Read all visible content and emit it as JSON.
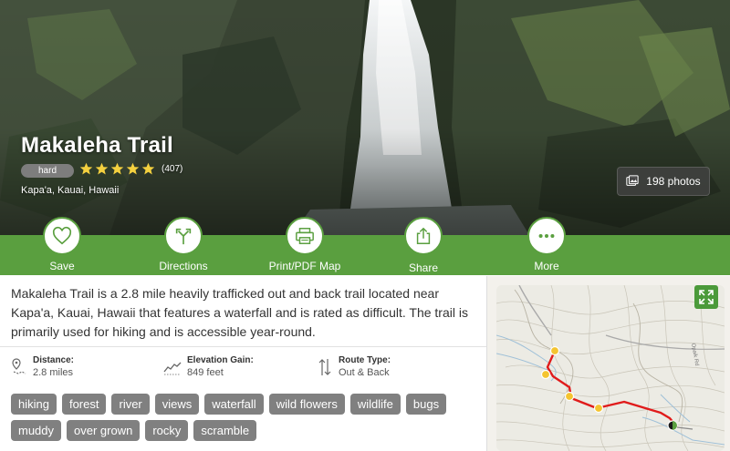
{
  "trail": {
    "title": "Makaleha Trail",
    "difficulty": "hard",
    "rating": 5,
    "review_count": "(407)",
    "location": "Kapa'a, Kauai, Hawaii",
    "photos_label": "198 photos"
  },
  "actions": [
    {
      "label": "Save",
      "icon": "heart-icon"
    },
    {
      "label": "Directions",
      "icon": "directions-icon"
    },
    {
      "label": "Print/PDF Map",
      "icon": "printer-icon"
    },
    {
      "label": "Share",
      "icon": "share-icon"
    },
    {
      "label": "More",
      "icon": "more-icon"
    }
  ],
  "description": "Makaleha Trail is a 2.8 mile heavily trafficked out and back trail located near Kapa'a, Kauai, Hawaii that features a waterfall and is rated as difficult. The trail is primarily used for hiking and is accessible year-round.",
  "stats": {
    "distance": {
      "label": "Distance:",
      "value": "2.8 miles",
      "icon": "map-pin-icon"
    },
    "elevation": {
      "label": "Elevation Gain:",
      "value": "849 feet",
      "icon": "elevation-icon"
    },
    "route": {
      "label": "Route Type:",
      "value": "Out & Back",
      "icon": "route-arrows-icon"
    }
  },
  "tags": [
    "hiking",
    "forest",
    "river",
    "views",
    "waterfall",
    "wild flowers",
    "wildlife",
    "bugs",
    "muddy",
    "over grown",
    "rocky",
    "scramble"
  ],
  "map": {
    "road_label": "Opaik Rd",
    "expand_icon": "expand-icon"
  },
  "colors": {
    "brand_green": "#5a9f3f",
    "trail_red": "#e01b1b",
    "waypoint_yellow": "#f4c430",
    "tag_gray": "#808080",
    "star_yellow": "#f4d03f"
  }
}
